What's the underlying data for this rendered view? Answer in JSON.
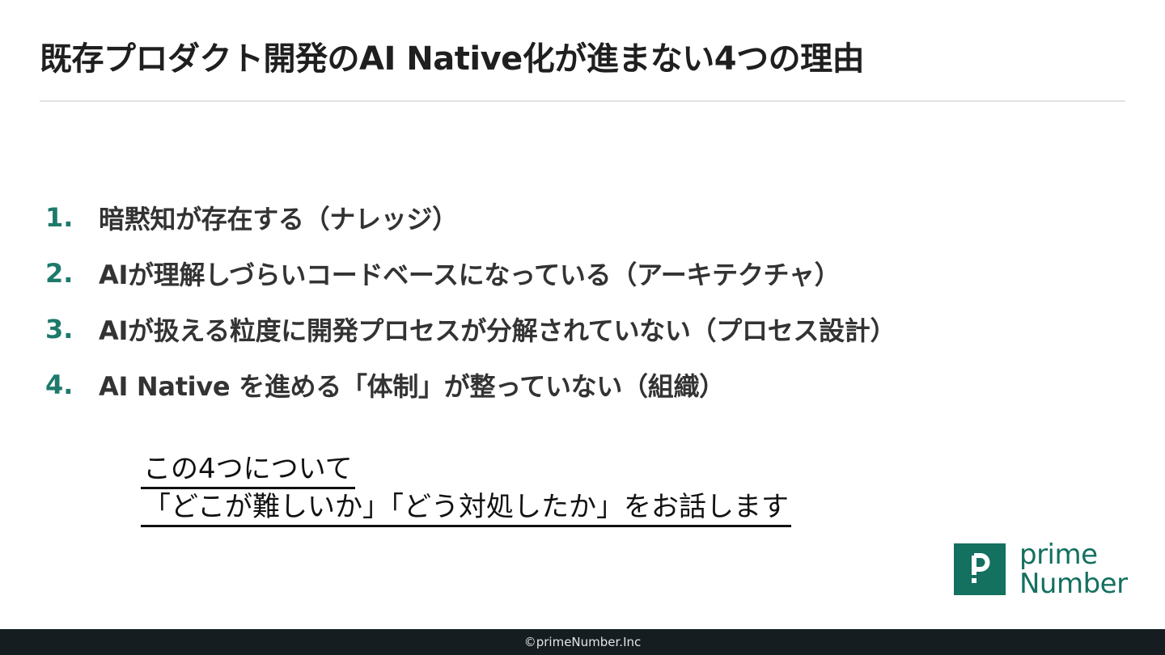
{
  "slide": {
    "title": "既存プロダクト開発のAI Native化が進まない4つの理由"
  },
  "reasons": [
    {
      "number": "1.",
      "text": "暗黙知が存在する（ナレッジ）"
    },
    {
      "number": "2.",
      "text": "AIが理解しづらいコードベースになっている（アーキテクチャ）"
    },
    {
      "number": "3.",
      "text": "AIが扱える粒度に開発プロセスが分解されていない（プロセス設計）"
    },
    {
      "number": "4.",
      "text": "AI Native を進める「体制」が整っていない（組織）"
    }
  ],
  "note": {
    "line1": "この4つについて",
    "line2": "「どこが難しいか」「どう対処したか」をお話します"
  },
  "logo": {
    "word1": "prime",
    "word2": "Number",
    "brand_color": "#14705f",
    "icon": "prime-number-p-icon"
  },
  "footer": {
    "copyright": "©primeNumber.Inc"
  },
  "colors": {
    "accent": "#1d7a6b",
    "footer_bg": "#151d21"
  }
}
